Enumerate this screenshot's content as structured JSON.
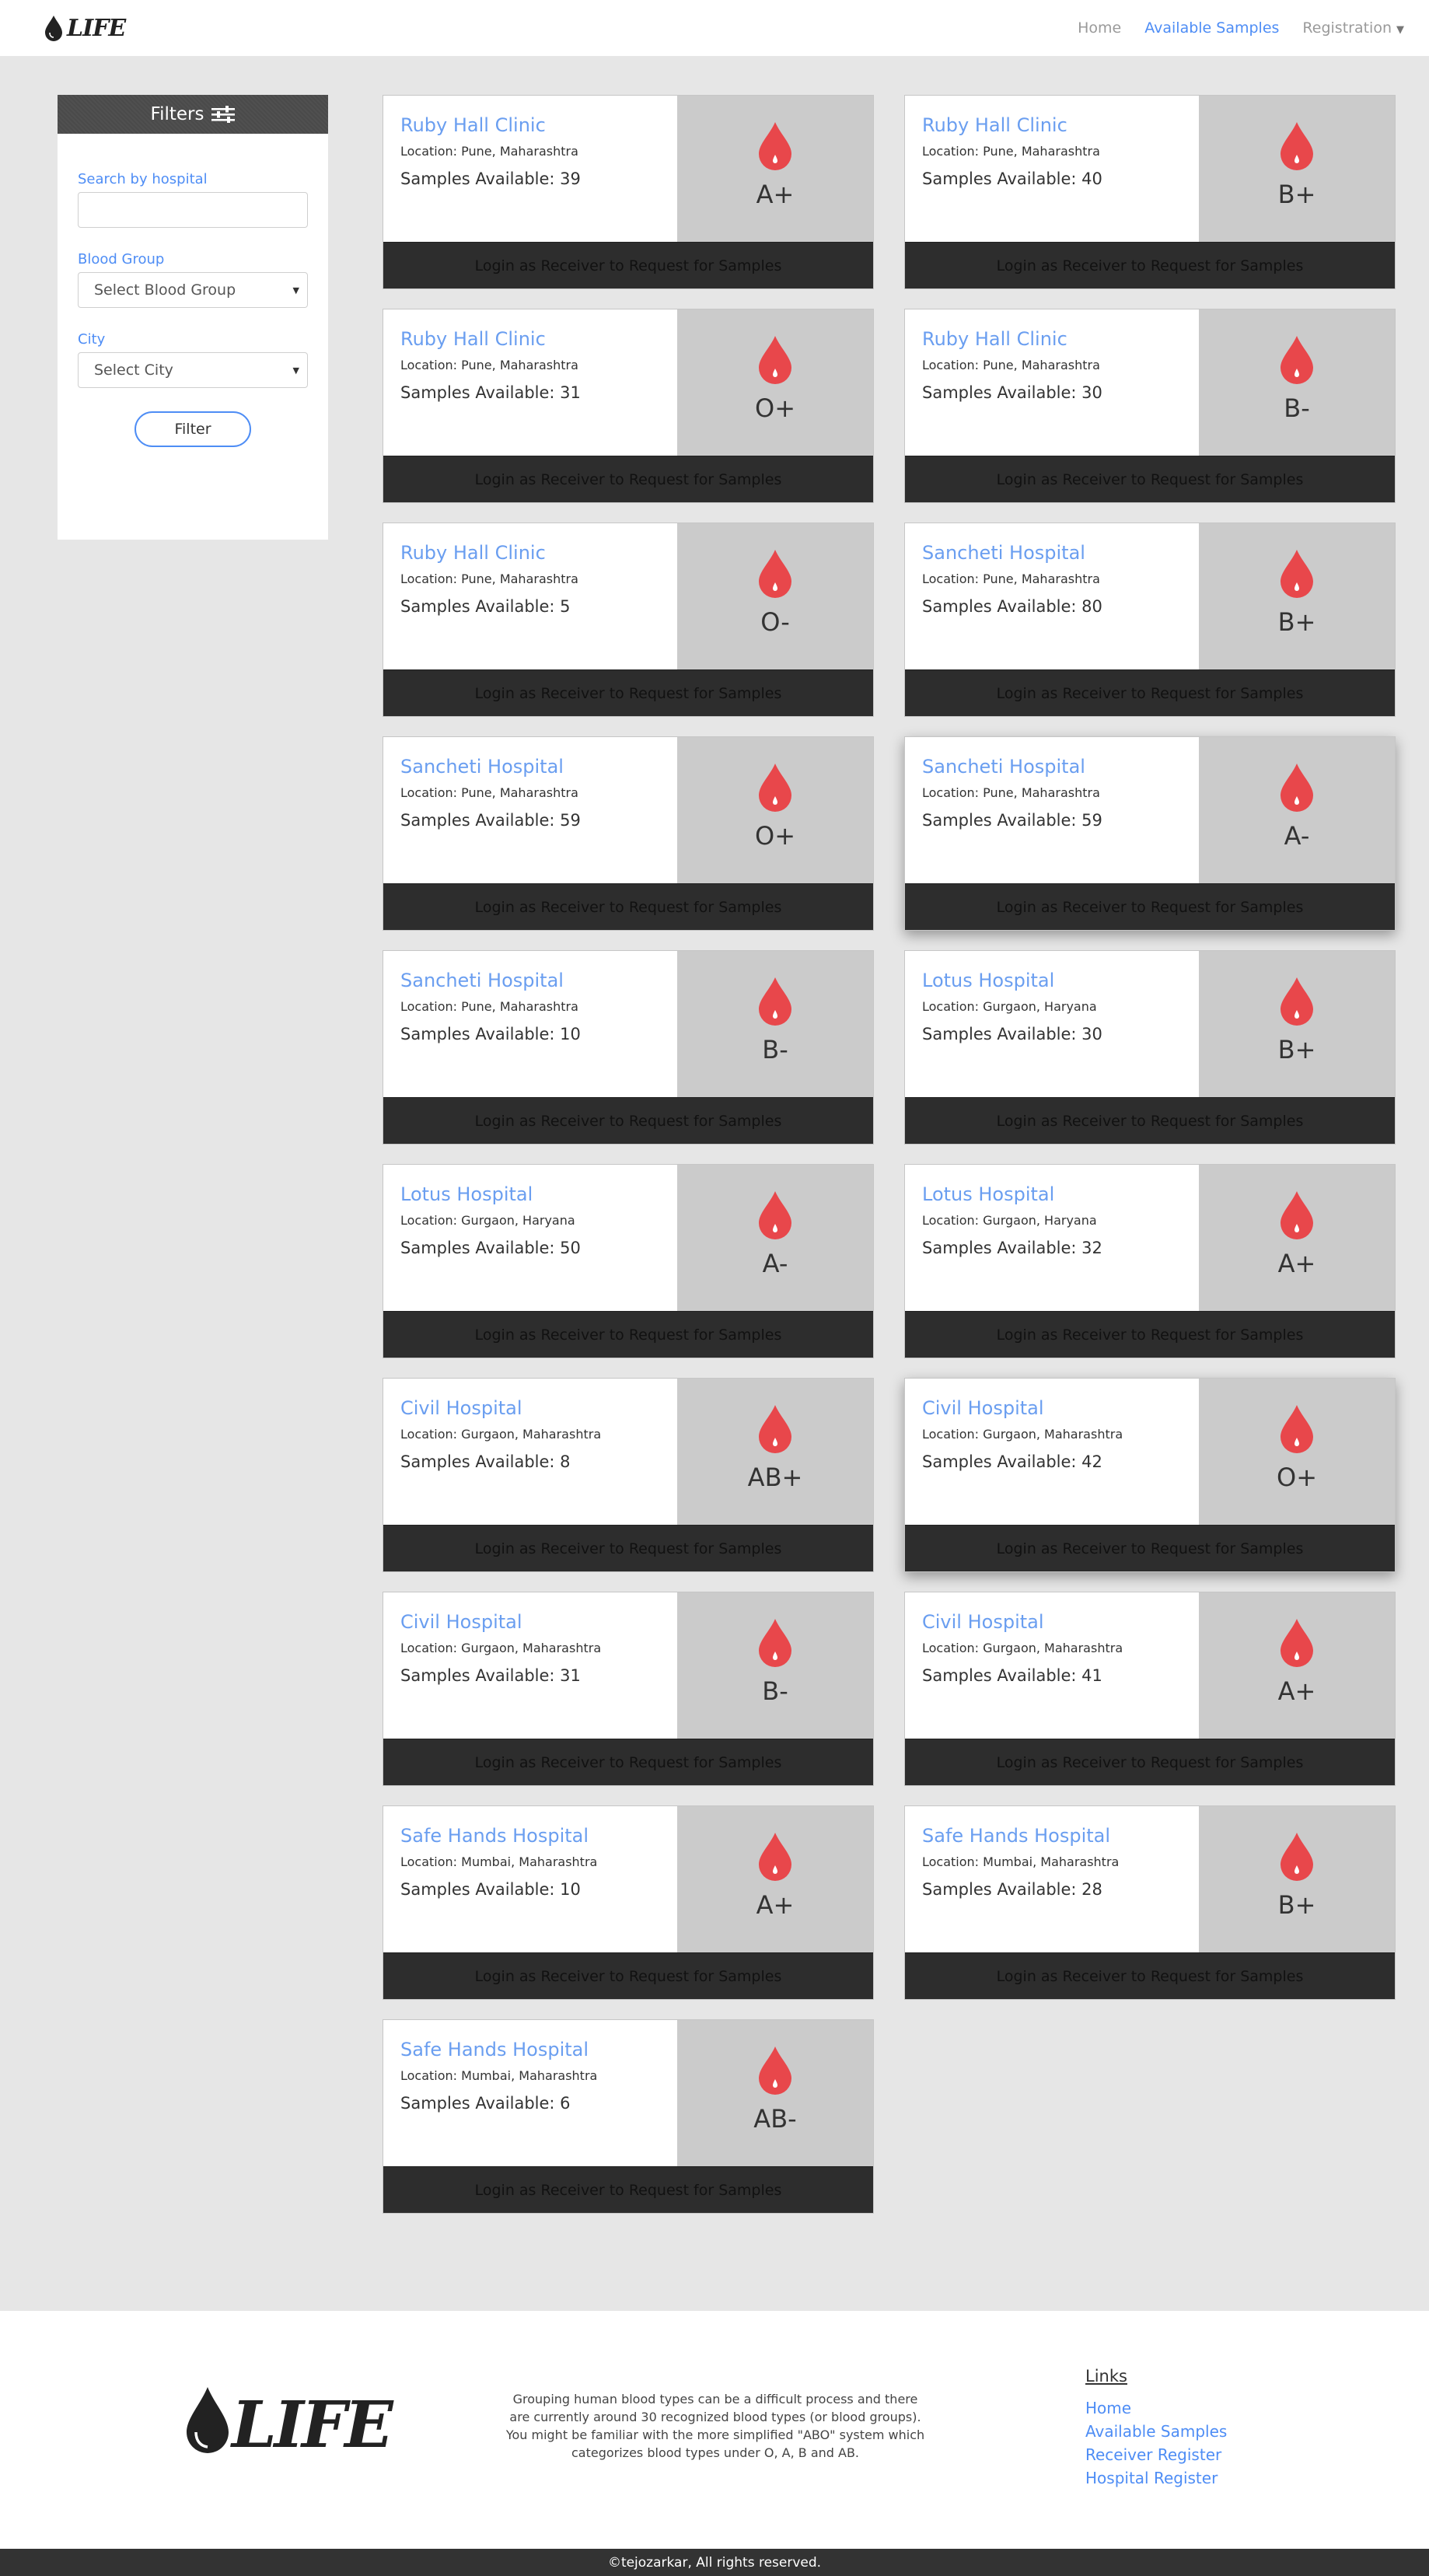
{
  "navbar": {
    "brand": "LIFE",
    "links": [
      "Home",
      "Available Samples",
      "Registration"
    ],
    "active_index": 1
  },
  "filters": {
    "title": "Filters",
    "search_label": "Search by hospital",
    "search_value": "",
    "blood_group_label": "Blood Group",
    "blood_group_value": "Select Blood Group",
    "city_label": "City",
    "city_value": "Select City",
    "button": "Filter"
  },
  "cards": [
    {
      "hospital": "Ruby Hall Clinic",
      "location": "Location: Pune, Maharashtra",
      "samples": "Samples Available: 39",
      "group": "A+",
      "button": "Login as Receiver to Request for Samples"
    },
    {
      "hospital": "Ruby Hall Clinic",
      "location": "Location: Pune, Maharashtra",
      "samples": "Samples Available: 40",
      "group": "B+",
      "button": "Login as Receiver to Request for Samples"
    },
    {
      "hospital": "Ruby Hall Clinic",
      "location": "Location: Pune, Maharashtra",
      "samples": "Samples Available: 31",
      "group": "O+",
      "button": "Login as Receiver to Request for Samples"
    },
    {
      "hospital": "Ruby Hall Clinic",
      "location": "Location: Pune, Maharashtra",
      "samples": "Samples Available: 30",
      "group": "B-",
      "button": "Login as Receiver to Request for Samples"
    },
    {
      "hospital": "Ruby Hall Clinic",
      "location": "Location: Pune, Maharashtra",
      "samples": "Samples Available: 5",
      "group": "O-",
      "button": "Login as Receiver to Request for Samples"
    },
    {
      "hospital": "Sancheti Hospital",
      "location": "Location: Pune, Maharashtra",
      "samples": "Samples Available: 80",
      "group": "B+",
      "button": "Login as Receiver to Request for Samples"
    },
    {
      "hospital": "Sancheti Hospital",
      "location": "Location: Pune, Maharashtra",
      "samples": "Samples Available: 59",
      "group": "O+",
      "button": "Login as Receiver to Request for Samples"
    },
    {
      "hospital": "Sancheti Hospital",
      "location": "Location: Pune, Maharashtra",
      "samples": "Samples Available: 59",
      "group": "A-",
      "button": "Login as Receiver to Request for Samples"
    },
    {
      "hospital": "Sancheti Hospital",
      "location": "Location: Pune, Maharashtra",
      "samples": "Samples Available: 10",
      "group": "B-",
      "button": "Login as Receiver to Request for Samples"
    },
    {
      "hospital": "Lotus Hospital",
      "location": "Location: Gurgaon, Haryana",
      "samples": "Samples Available: 30",
      "group": "B+",
      "button": "Login as Receiver to Request for Samples"
    },
    {
      "hospital": "Lotus Hospital",
      "location": "Location: Gurgaon, Haryana",
      "samples": "Samples Available: 50",
      "group": "A-",
      "button": "Login as Receiver to Request for Samples"
    },
    {
      "hospital": "Lotus Hospital",
      "location": "Location: Gurgaon, Haryana",
      "samples": "Samples Available: 32",
      "group": "A+",
      "button": "Login as Receiver to Request for Samples"
    },
    {
      "hospital": "Civil Hospital",
      "location": "Location: Gurgaon, Maharashtra",
      "samples": "Samples Available: 8",
      "group": "AB+",
      "button": "Login as Receiver to Request for Samples"
    },
    {
      "hospital": "Civil Hospital",
      "location": "Location: Gurgaon, Maharashtra",
      "samples": "Samples Available: 42",
      "group": "O+",
      "button": "Login as Receiver to Request for Samples"
    },
    {
      "hospital": "Civil Hospital",
      "location": "Location: Gurgaon, Maharashtra",
      "samples": "Samples Available: 31",
      "group": "B-",
      "button": "Login as Receiver to Request for Samples"
    },
    {
      "hospital": "Civil Hospital",
      "location": "Location: Gurgaon, Maharashtra",
      "samples": "Samples Available: 41",
      "group": "A+",
      "button": "Login as Receiver to Request for Samples"
    },
    {
      "hospital": "Safe Hands Hospital",
      "location": "Location: Mumbai, Maharashtra",
      "samples": "Samples Available: 10",
      "group": "A+",
      "button": "Login as Receiver to Request for Samples"
    },
    {
      "hospital": "Safe Hands Hospital",
      "location": "Location: Mumbai, Maharashtra",
      "samples": "Samples Available: 28",
      "group": "B+",
      "button": "Login as Receiver to Request for Samples"
    },
    {
      "hospital": "Safe Hands Hospital",
      "location": "Location: Mumbai, Maharashtra",
      "samples": "Samples Available: 6",
      "group": "AB-",
      "button": "Login as Receiver to Request for Samples"
    }
  ],
  "footer": {
    "brand": "LIFE",
    "description": "Grouping human blood types can be a difficult process and there are currently around 30 recognized blood types (or blood groups). You might be familiar with the more simplified \"ABO\" system which categorizes blood types under O, A, B and AB.",
    "links_title": "Links",
    "links": [
      "Home",
      "Available Samples",
      "Receiver Register",
      "Hospital Register"
    ],
    "copyright": "©tejozarkar, All rights reserved."
  },
  "colors": {
    "accent": "#4e8df5",
    "hospital_name": "#6a9ef0",
    "blood_drop": "#e8474b",
    "blood_panel": "#cbcbcb",
    "card_button": "#2d2d2d",
    "page_background": "#e6e6e6"
  }
}
